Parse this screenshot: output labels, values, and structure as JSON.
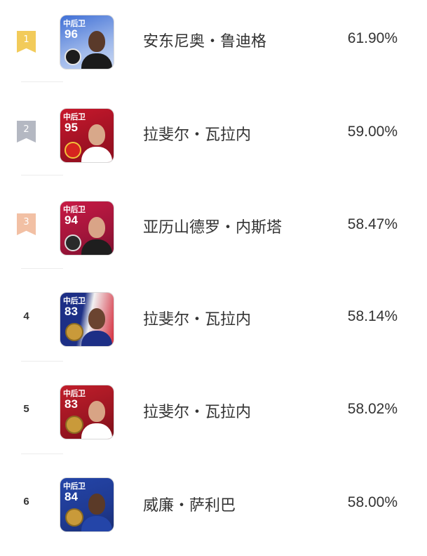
{
  "rows": [
    {
      "rank": "1",
      "badge": "ribbon",
      "badge_color": "#f2cb5a",
      "card": {
        "position": "中后卫",
        "rating": "96",
        "bg": "#3f6fd6",
        "bg2": "#c9d8f3",
        "skin": "#5a3a2a",
        "shirt": "#1a1a1a",
        "crest": "#1c1c1c"
      },
      "name": "安东尼奥・鲁迪格",
      "percent": "61.90%"
    },
    {
      "rank": "2",
      "badge": "ribbon",
      "badge_color": "#b4b8c2",
      "card": {
        "position": "中后卫",
        "rating": "95",
        "bg": "#c8182c",
        "bg2": "#8e0e1d",
        "skin": "#d8a88a",
        "shirt": "#ffffff",
        "crest": "#d6241f"
      },
      "name": "拉斐尔・瓦拉内",
      "percent": "59.00%"
    },
    {
      "rank": "3",
      "badge": "ribbon",
      "badge_color": "#f2c0a4",
      "card": {
        "position": "中后卫",
        "rating": "94",
        "bg": "#c81a45",
        "bg2": "#7e0f2e",
        "skin": "#d9a487",
        "shirt": "#1e1e1e",
        "crest": "#2a2a2a"
      },
      "name": "亚历山德罗・内斯塔",
      "percent": "58.47%"
    },
    {
      "rank": "4",
      "badge": "number",
      "badge_color": "#333333",
      "card": {
        "position": "中后卫",
        "rating": "83",
        "bg": "#1d2f86",
        "bg2": "#d42a3a",
        "skin": "#6b4430",
        "shirt": "#1d2f86",
        "crest": "#c99a3a"
      },
      "name": "拉斐尔・瓦拉内",
      "percent": "58.14%"
    },
    {
      "rank": "5",
      "badge": "number",
      "badge_color": "#333333",
      "card": {
        "position": "中后卫",
        "rating": "83",
        "bg": "#c11e2b",
        "bg2": "#7a0e17",
        "skin": "#d8a485",
        "shirt": "#ffffff",
        "crest": "#c99a3a"
      },
      "name": "拉斐尔・瓦拉内",
      "percent": "58.02%"
    },
    {
      "rank": "6",
      "badge": "number",
      "badge_color": "#333333",
      "card": {
        "position": "中后卫",
        "rating": "84",
        "bg": "#2445a8",
        "bg2": "#1a2e73",
        "skin": "#5b3a28",
        "shirt": "#2445a8",
        "crest": "#c99a3a"
      },
      "name": "威廉・萨利巴",
      "percent": "58.00%"
    }
  ]
}
